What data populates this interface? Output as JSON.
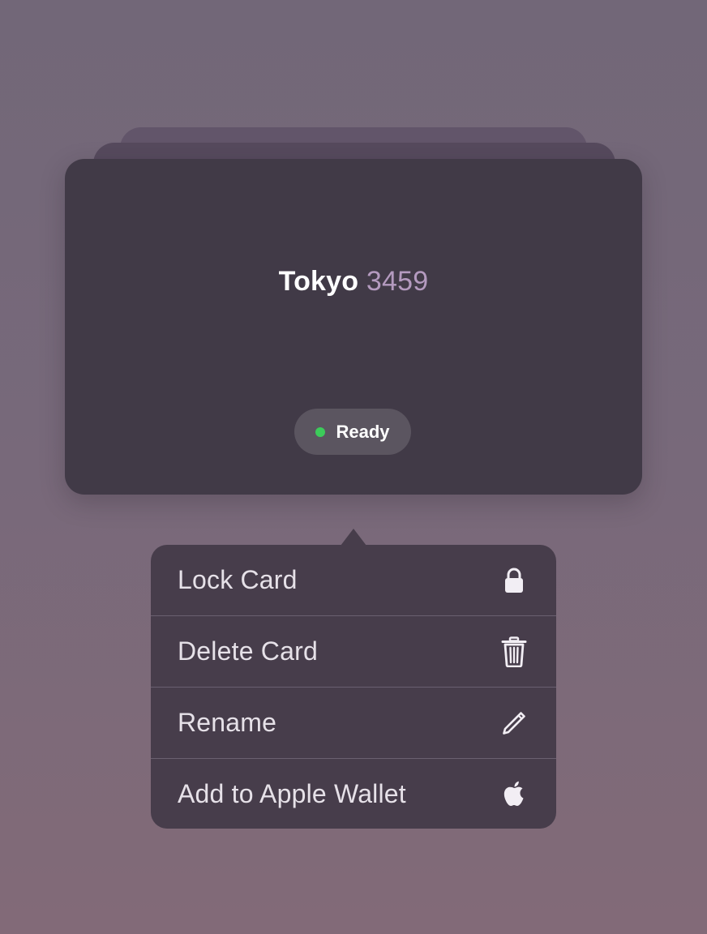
{
  "card": {
    "name": "Tokyo",
    "number": "3459",
    "status": "Ready",
    "status_color": "#3ccb5a",
    "name_color": "#ffffff",
    "number_color": "#b49abf"
  },
  "menu": {
    "items": [
      {
        "label": "Lock Card",
        "icon": "lock-icon"
      },
      {
        "label": "Delete Card",
        "icon": "trash-icon"
      },
      {
        "label": "Rename",
        "icon": "pencil-icon"
      },
      {
        "label": "Add to Apple Wallet",
        "icon": "apple-icon"
      }
    ]
  }
}
